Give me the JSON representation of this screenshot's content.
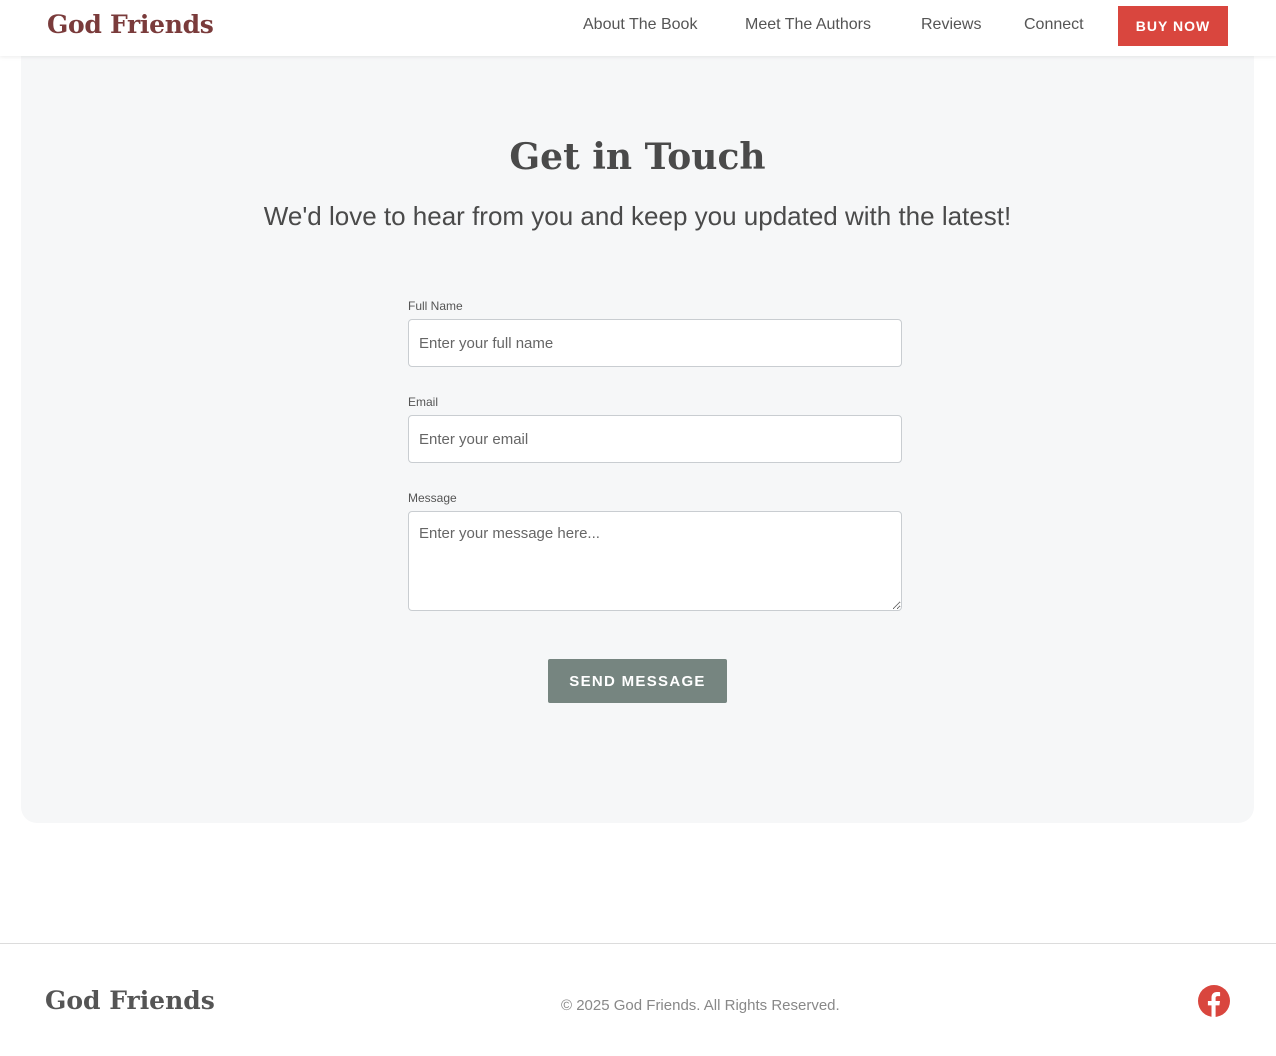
{
  "header": {
    "logo": "God Friends",
    "nav": [
      "About The Book",
      "Meet The Authors",
      "Reviews",
      "Connect"
    ],
    "buy_label": "BUY NOW"
  },
  "contact": {
    "title": "Get in Touch",
    "subtitle": "We'd love to hear from you and keep you updated with the latest!",
    "fields": [
      {
        "label": "Full Name",
        "placeholder": "Enter your full name"
      },
      {
        "label": "Email",
        "placeholder": "Enter your email"
      },
      {
        "label": "Message",
        "placeholder": "Enter your message here..."
      }
    ],
    "send_label": "SEND MESSAGE"
  },
  "footer": {
    "logo": "God Friends",
    "copyright": "© 2025 God Friends. All Rights Reserved.",
    "social_icon": "facebook-icon"
  },
  "colors": {
    "brand": "#7a3b3b",
    "accent": "#d9463e",
    "send_button": "#768580",
    "facebook": "#d9463e"
  }
}
